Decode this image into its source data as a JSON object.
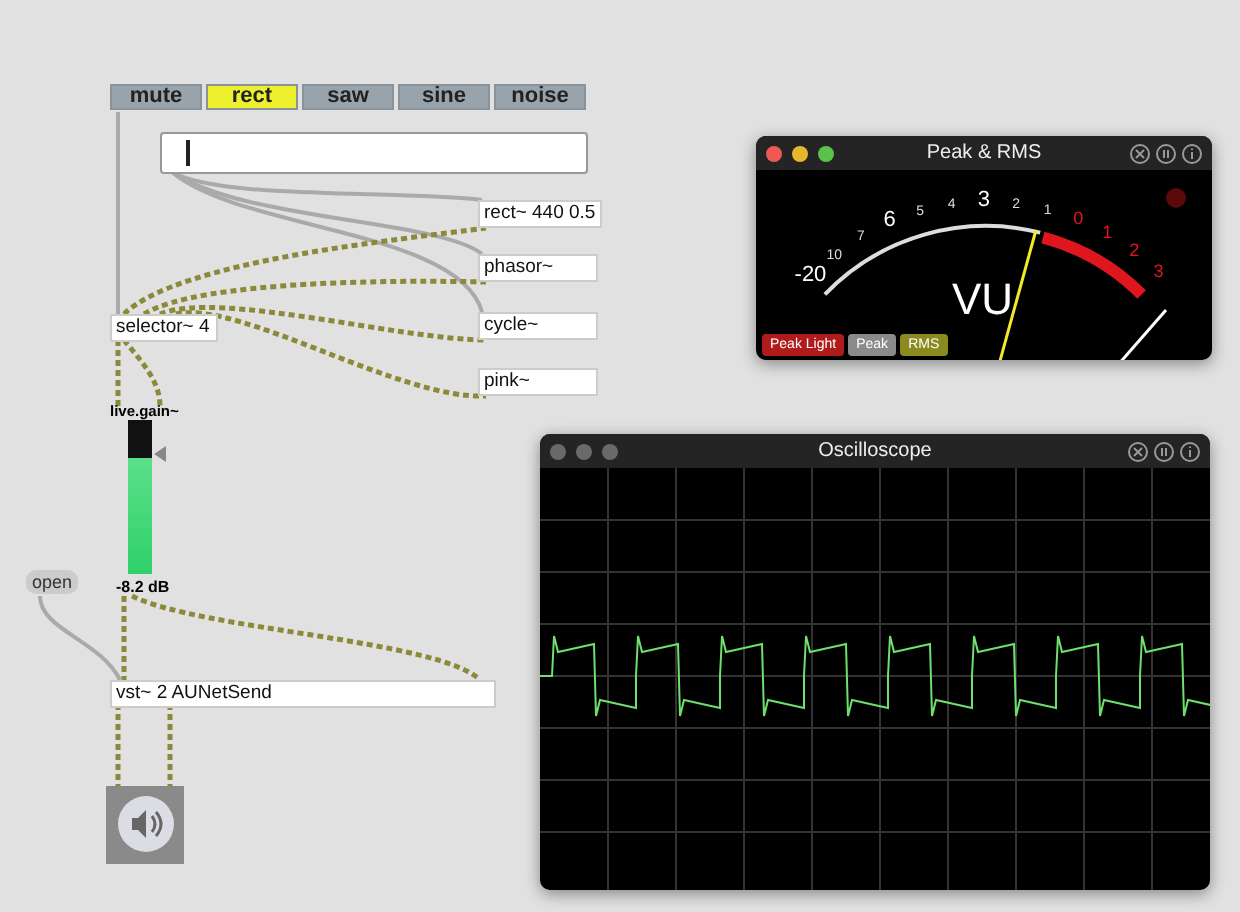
{
  "tabs": [
    {
      "label": "mute",
      "selected": false
    },
    {
      "label": "rect",
      "selected": true
    },
    {
      "label": "saw",
      "selected": false
    },
    {
      "label": "sine",
      "selected": false
    },
    {
      "label": "noise",
      "selected": false
    }
  ],
  "objects": [
    {
      "text": "rect~ 440 0.5"
    },
    {
      "text": "phasor~"
    },
    {
      "text": "selector~ 4"
    },
    {
      "text": "cycle~"
    },
    {
      "text": "pink~"
    },
    {
      "text": "vst~ 2 AUNetSend"
    }
  ],
  "live_gain": {
    "label": "live.gain~",
    "level": 0.75,
    "reading": "-8.2 dB"
  },
  "open_message": "open",
  "vu_window": {
    "title": "Peak & RMS",
    "scale": [
      {
        "text": "-20",
        "kind": "major"
      },
      {
        "text": "10",
        "kind": "minor"
      },
      {
        "text": "7",
        "kind": "minor"
      },
      {
        "text": "6",
        "kind": "major"
      },
      {
        "text": "5",
        "kind": "minor"
      },
      {
        "text": "4",
        "kind": "minor"
      },
      {
        "text": "3",
        "kind": "major"
      },
      {
        "text": "2",
        "kind": "minor"
      },
      {
        "text": "1",
        "kind": "minor"
      },
      {
        "text": "0",
        "kind": "red"
      },
      {
        "text": "1",
        "kind": "red"
      },
      {
        "text": "2",
        "kind": "red"
      },
      {
        "text": "3",
        "kind": "red"
      }
    ],
    "unit": "VU",
    "buttons": [
      {
        "label": "Peak Light",
        "color": "#b01c1c"
      },
      {
        "label": "Peak",
        "color": "#8a8a8a"
      },
      {
        "label": "RMS",
        "color": "#8a8a1e"
      }
    ]
  },
  "scope_window": {
    "title": "Oscilloscope"
  }
}
